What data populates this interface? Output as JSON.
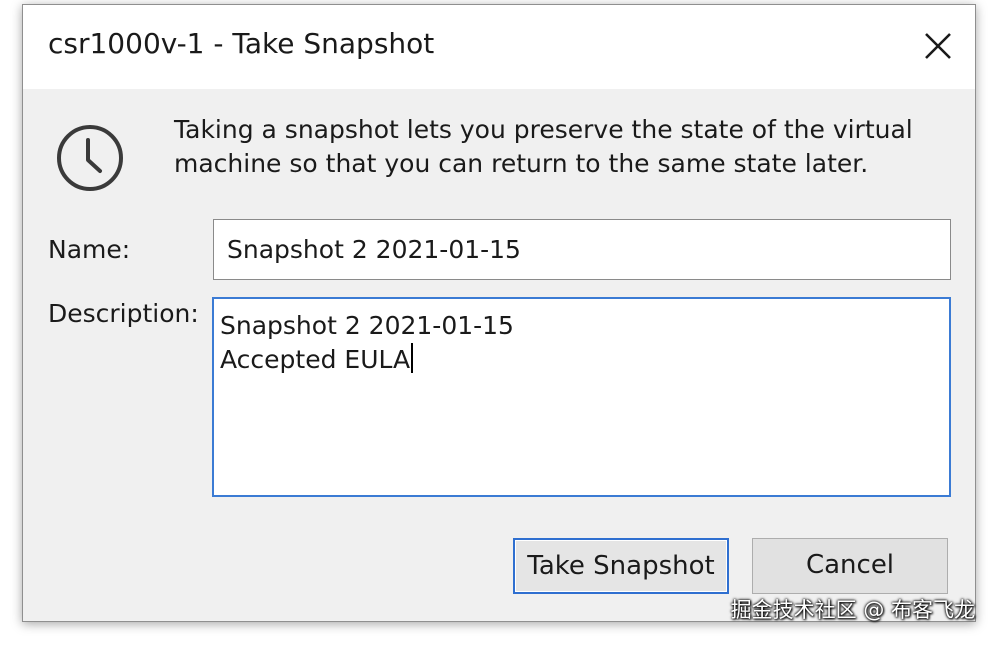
{
  "window": {
    "title": "csr1000v-1 - Take Snapshot"
  },
  "info": {
    "icon": "clock-icon",
    "text": "Taking a snapshot lets you preserve the state of the virtual machine so that you can return to the same state later."
  },
  "form": {
    "name_label": "Name:",
    "name_value": "Snapshot 2 2021-01-15",
    "description_label": "Description:",
    "description_lines": [
      "Snapshot 2 2021-01-15",
      "Accepted EULA"
    ]
  },
  "buttons": {
    "take_snapshot": "Take Snapshot",
    "cancel": "Cancel"
  },
  "watermark": "掘金技术社区 @ 布客飞龙",
  "colors": {
    "dialog_bg": "#f0f0f0",
    "focus_border": "#3b7bd4",
    "default_button_border": "#2f6fd0"
  }
}
